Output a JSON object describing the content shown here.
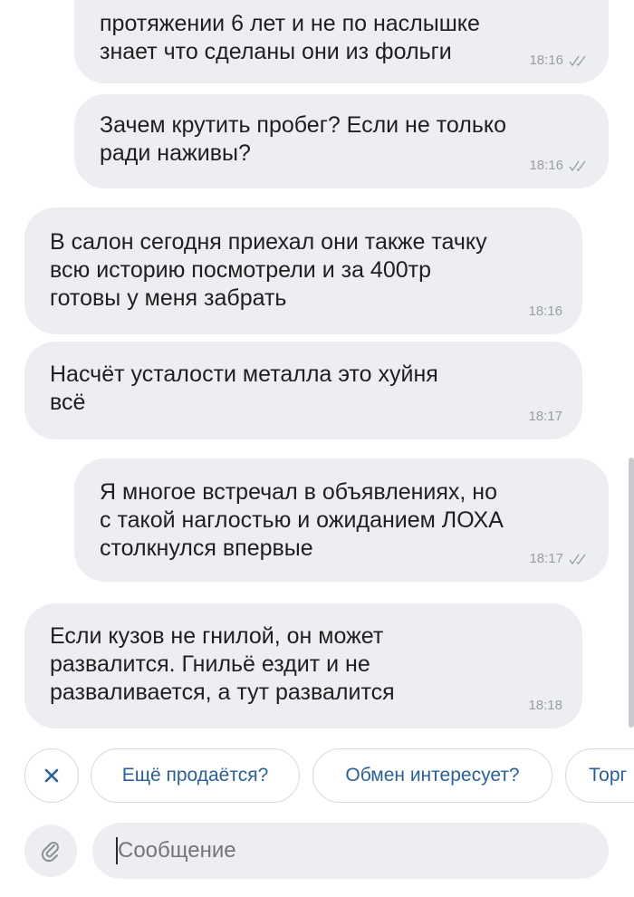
{
  "messages": [
    {
      "direction": "outgoing",
      "text": "протяжении 6 лет и не по наслышке\nзнает что сделаны они из фольги",
      "time": "18:16",
      "read": true
    },
    {
      "direction": "outgoing",
      "text": "Зачем крутить пробег? Если не только\nради наживы?",
      "time": "18:16",
      "read": true
    },
    {
      "direction": "incoming",
      "text": "В салон сегодня приехал они также тачку\nвсю историю посмотрели и за 400тр\nготовы у меня забрать",
      "time": "18:16"
    },
    {
      "direction": "incoming",
      "text": "Насчёт усталости металла это хуйня\nвсё",
      "time": "18:17"
    },
    {
      "direction": "outgoing",
      "text": "Я многое встречал в объявлениях, но\nс такой наглостью и ожиданием ЛОХА\nстолкнулся впервые",
      "time": "18:17",
      "read": true
    },
    {
      "direction": "incoming",
      "text": "Если кузов не гнилой, он может\nразвалится. Гнильё ездит и не\nразваливается, а тут развалится",
      "time": "18:18"
    }
  ],
  "quick_replies": {
    "close_icon": "close-icon",
    "items": [
      "Ещё продаётся?",
      "Обмен интересует?",
      "Торг"
    ]
  },
  "composer": {
    "attach_icon": "paperclip-icon",
    "placeholder": "Сообщение",
    "value": ""
  },
  "colors": {
    "bubble": "#edeef2",
    "chip_text": "#2b5f98",
    "time": "#9a9da3"
  }
}
